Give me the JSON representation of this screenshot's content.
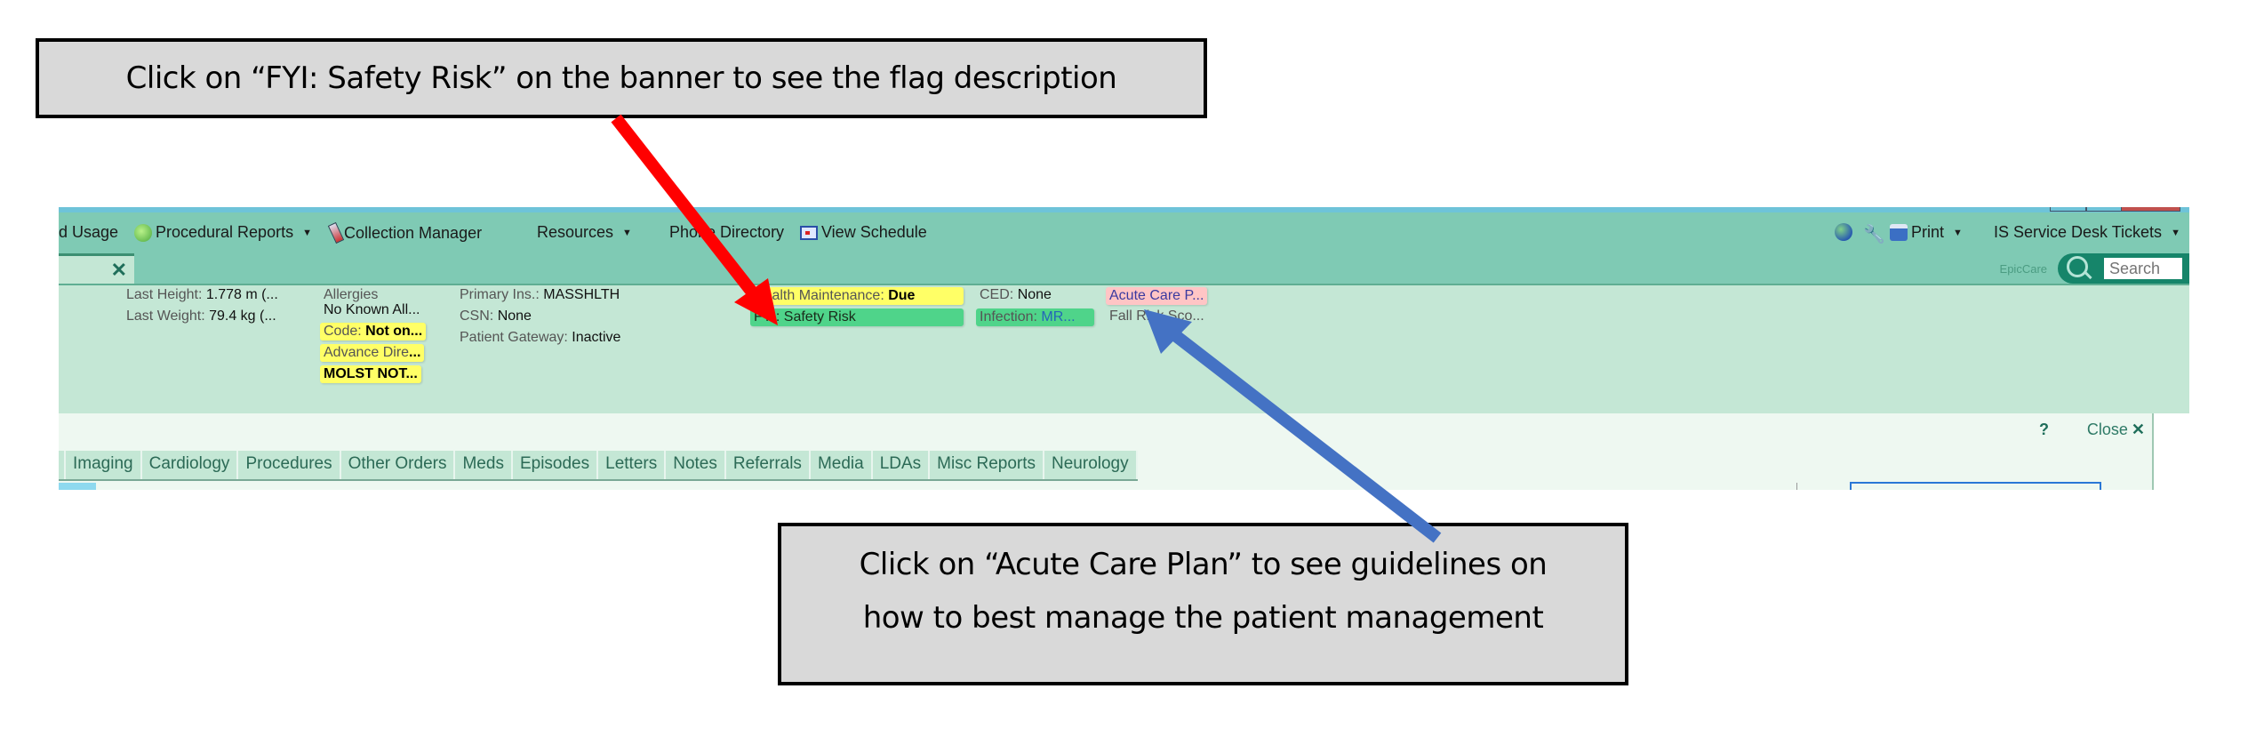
{
  "callouts": {
    "fyi": "Click on “FYI: Safety Risk” on the banner to see the flag description",
    "acp_line1": "Click on “Acute Care Plan” to see guidelines on",
    "acp_line2": "how to best manage the patient management"
  },
  "arrows": {
    "fyi_color": "#ff0000",
    "acp_color": "#4472c4"
  },
  "toolbar": {
    "items": [
      {
        "label": "d Usage",
        "icon": "none"
      },
      {
        "label": "Procedural Reports",
        "icon": "surgeon-icon",
        "dropdown": true
      },
      {
        "label": "Collection Manager",
        "icon": "test-tube-icon"
      },
      {
        "label": "Resources",
        "dropdown": true
      },
      {
        "label": "Phone Directory"
      },
      {
        "label": "View Schedule",
        "icon": "calendar-icon"
      }
    ],
    "right": {
      "print": "Print",
      "service_desk": "IS Service Desk Tickets"
    }
  },
  "tabrow": {
    "brand": "EpicCare",
    "search_placeholder": "Search"
  },
  "banner": {
    "last_height_label": "Last Height:",
    "last_height_value": "1.778 m (...",
    "last_weight_label": "Last Weight:",
    "last_weight_value": "79.4 kg (...",
    "allergies_label": "Allergies",
    "allergies_value": "No Known All...",
    "code_label": "Code:",
    "code_value": "Not on...",
    "advance_label": "Advance Dire",
    "advance_ellipsis": "...",
    "molst": "MOLST NOT...",
    "primary_ins_label": "Primary Ins.:",
    "primary_ins_value": "MASSHLTH",
    "csn_label": "CSN:",
    "csn_value": "None",
    "gateway_label": "Patient Gateway:",
    "gateway_value": "Inactive",
    "health_maint_label": "Health Maintenance:",
    "health_maint_value": "Due",
    "fyi": "FYI: Safety Risk",
    "ced_label": "CED:",
    "ced_value": "None",
    "infection_label": "Infection:",
    "infection_value": "MR...",
    "acute_care": "Acute Care P...",
    "fall_risk": "Fall Risk Sco..."
  },
  "activity": {
    "help": "?",
    "close": "Close",
    "tabs": [
      "Imaging",
      "Cardiology",
      "Procedures",
      "Other Orders",
      "Meds",
      "Episodes",
      "Letters",
      "Notes",
      "Referrals",
      "Media",
      "LDAs",
      "Misc Reports",
      "Neurology"
    ]
  }
}
